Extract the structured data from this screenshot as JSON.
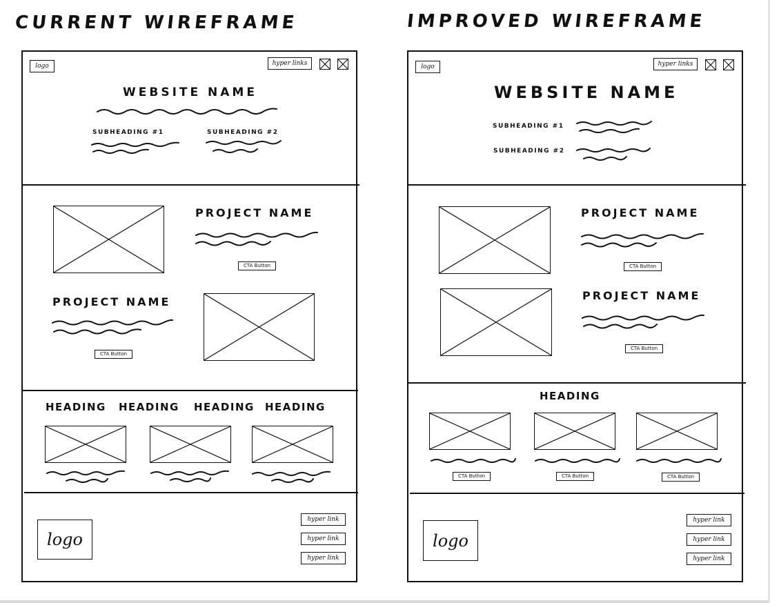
{
  "titles": {
    "left": "CURRENT   WIREFRAME",
    "right": "IMPROVED   WIREFRAME"
  },
  "current": {
    "logo_label": "logo",
    "hyperlinks_label": "hyper links",
    "website_name": "WEBSITE  NAME",
    "subheading_1": "SUBHEADING  #1",
    "subheading_2": "SUBHEADING  #2",
    "project_1_name": "PROJECT  NAME",
    "project_1_cta": "CTA Button",
    "project_2_name": "PROJECT  NAME",
    "project_2_cta": "CTA Button",
    "headings": [
      "HEADING",
      "HEADING",
      "HEADING",
      "HEADING"
    ],
    "footer_logo": "logo",
    "footer_links": [
      "hyper link",
      "hyper link",
      "hyper link"
    ]
  },
  "improved": {
    "logo_label": "logo",
    "hyperlinks_label": "hyper links",
    "website_name": "WEBSITE  NAME",
    "subheading_1": "SUBHEADING  #1",
    "subheading_2": "SUBHEADING  #2",
    "project_1_name": "PROJECT  NAME",
    "project_1_cta": "CTA Button",
    "project_2_name": "PROJECT  NAME",
    "project_2_cta": "CTA Button",
    "heading": "HEADING",
    "card_ctas": [
      "CTA Button",
      "CTA Button",
      "CTA Button"
    ],
    "footer_logo": "logo",
    "footer_links": [
      "hyper link",
      "hyper link",
      "hyper link"
    ]
  }
}
